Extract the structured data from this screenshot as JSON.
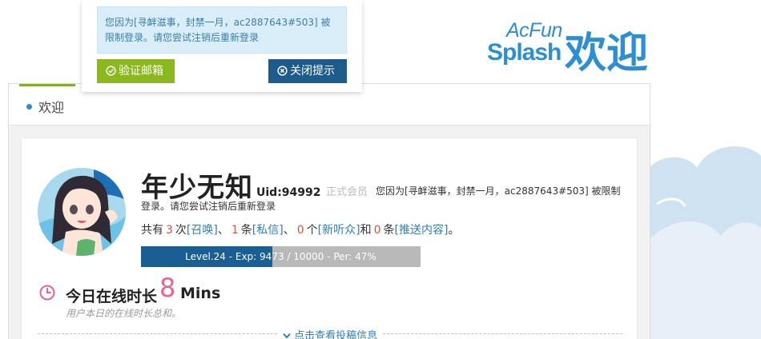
{
  "logo": {
    "brand_top": "AcFun",
    "brand_bottom": "Splash",
    "welcome": "欢迎"
  },
  "tabs": {
    "active_label": "欢迎"
  },
  "profile": {
    "username": "年少无知",
    "uid": "Uid:94992",
    "member_type": "正式会员",
    "ban_message": "您因为[寻衅滋事，封禁一月，ac2887643#503] 被限制登录。请您尝试注销后重新登录"
  },
  "stats": {
    "prefix": "共有",
    "summon_count": "3",
    "summon_unit": "次",
    "summon_link": "[召唤]",
    "sep1": "、",
    "pm_count": "1",
    "pm_unit": "条",
    "pm_link": "[私信]",
    "sep2": "、",
    "listener_count": "0",
    "listener_unit": "个",
    "listener_link": "[新听众]",
    "and": "和",
    "push_count": "0",
    "push_unit": "条",
    "push_link": "[推送内容]",
    "end": "。"
  },
  "level": {
    "text": "Level.24 - Exp: 9473 / 10000 - Per: 47%",
    "fill_fraction": 0.47
  },
  "online": {
    "title": "今日在线时长",
    "value": "8",
    "unit": "Mins",
    "subtitle": "用户本日的在线时长总和。"
  },
  "expand": {
    "label": "点击查看投稿信息"
  },
  "popup": {
    "message": "您因为[寻衅滋事，封禁一月，ac2887643#503] 被限制登录。请您尝试注销后重新登录",
    "verify_label": "验证邮箱",
    "close_label": "关闭提示"
  },
  "colors": {
    "brand_blue": "#2d8fd3",
    "verify_green": "#8bb81c",
    "close_navy": "#1d5b8c",
    "level_fill": "#1a5f93",
    "count_red": "#e0523b",
    "online_pink": "#e8658d"
  },
  "icons": {
    "verify": "check-circle-icon",
    "close": "close-circle-icon",
    "online": "clock-icon",
    "expand": "chevron-down-icon",
    "tab_bullet": "dot-icon"
  }
}
